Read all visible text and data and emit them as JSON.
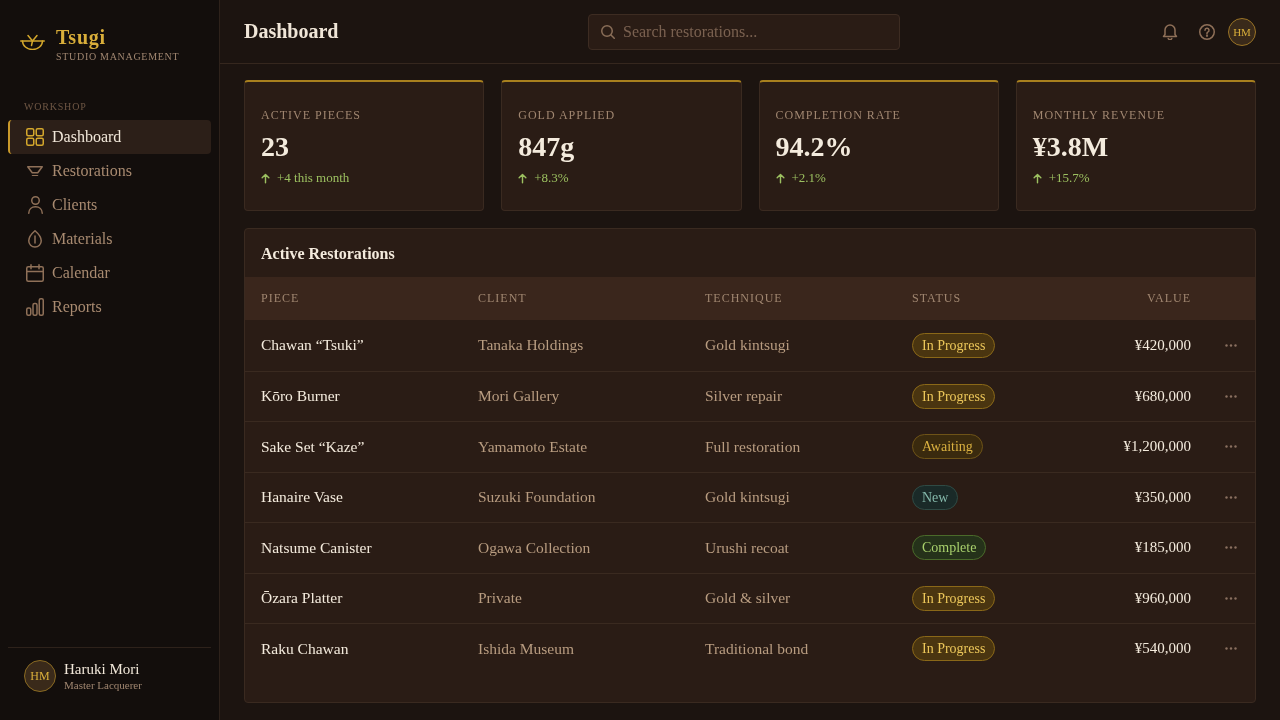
{
  "sidebar": {
    "brand": {
      "name": "Tsugi",
      "tagline": "STUDIO MANAGEMENT"
    },
    "section_label": "WORKSHOP",
    "items": [
      {
        "label": "Dashboard",
        "selected": true
      },
      {
        "label": "Restorations",
        "selected": false
      },
      {
        "label": "Clients",
        "selected": false
      },
      {
        "label": "Materials",
        "selected": false
      },
      {
        "label": "Calendar",
        "selected": false
      },
      {
        "label": "Reports",
        "selected": false
      }
    ],
    "user": {
      "initials": "HM",
      "name": "Haruki Mori",
      "role": "Master Lacquerer"
    }
  },
  "header": {
    "title": "Dashboard",
    "search": {
      "placeholder": "Search restorations..."
    },
    "avatar_initials": "HM"
  },
  "stats": [
    {
      "label": "ACTIVE PIECES",
      "value": "23",
      "change": "+4 this month"
    },
    {
      "label": "GOLD APPLIED",
      "value": "847g",
      "change": "+8.3%"
    },
    {
      "label": "COMPLETION RATE",
      "value": "94.2%",
      "change": "+2.1%"
    },
    {
      "label": "MONTHLY REVENUE",
      "value": "¥3.8M",
      "change": "+15.7%"
    }
  ],
  "table": {
    "title": "Active Restorations",
    "columns": [
      "PIECE",
      "CLIENT",
      "TECHNIQUE",
      "STATUS",
      "VALUE"
    ],
    "rows": [
      {
        "piece": "Chawan “Tsuki”",
        "client": "Tanaka Holdings",
        "technique": "Gold kintsugi",
        "status": {
          "label": "In Progress",
          "kind": "progress"
        },
        "value": "¥420,000"
      },
      {
        "piece": "Kōro Burner",
        "client": "Mori Gallery",
        "technique": "Silver repair",
        "status": {
          "label": "In Progress",
          "kind": "progress"
        },
        "value": "¥680,000"
      },
      {
        "piece": "Sake Set “Kaze”",
        "client": "Yamamoto Estate",
        "technique": "Full restoration",
        "status": {
          "label": "Awaiting",
          "kind": "awaiting"
        },
        "value": "¥1,200,000"
      },
      {
        "piece": "Hanaire Vase",
        "client": "Suzuki Foundation",
        "technique": "Gold kintsugi",
        "status": {
          "label": "New",
          "kind": "new"
        },
        "value": "¥350,000"
      },
      {
        "piece": "Natsume Canister",
        "client": "Ogawa Collection",
        "technique": "Urushi recoat",
        "status": {
          "label": "Complete",
          "kind": "complete"
        },
        "value": "¥185,000"
      },
      {
        "piece": "Ōzara Platter",
        "client": "Private",
        "technique": "Gold & silver",
        "status": {
          "label": "In Progress",
          "kind": "progress"
        },
        "value": "¥960,000"
      },
      {
        "piece": "Raku Chawan",
        "client": "Ishida Museum",
        "technique": "Traditional bond",
        "status": {
          "label": "In Progress",
          "kind": "progress"
        },
        "value": "¥540,000"
      }
    ]
  }
}
